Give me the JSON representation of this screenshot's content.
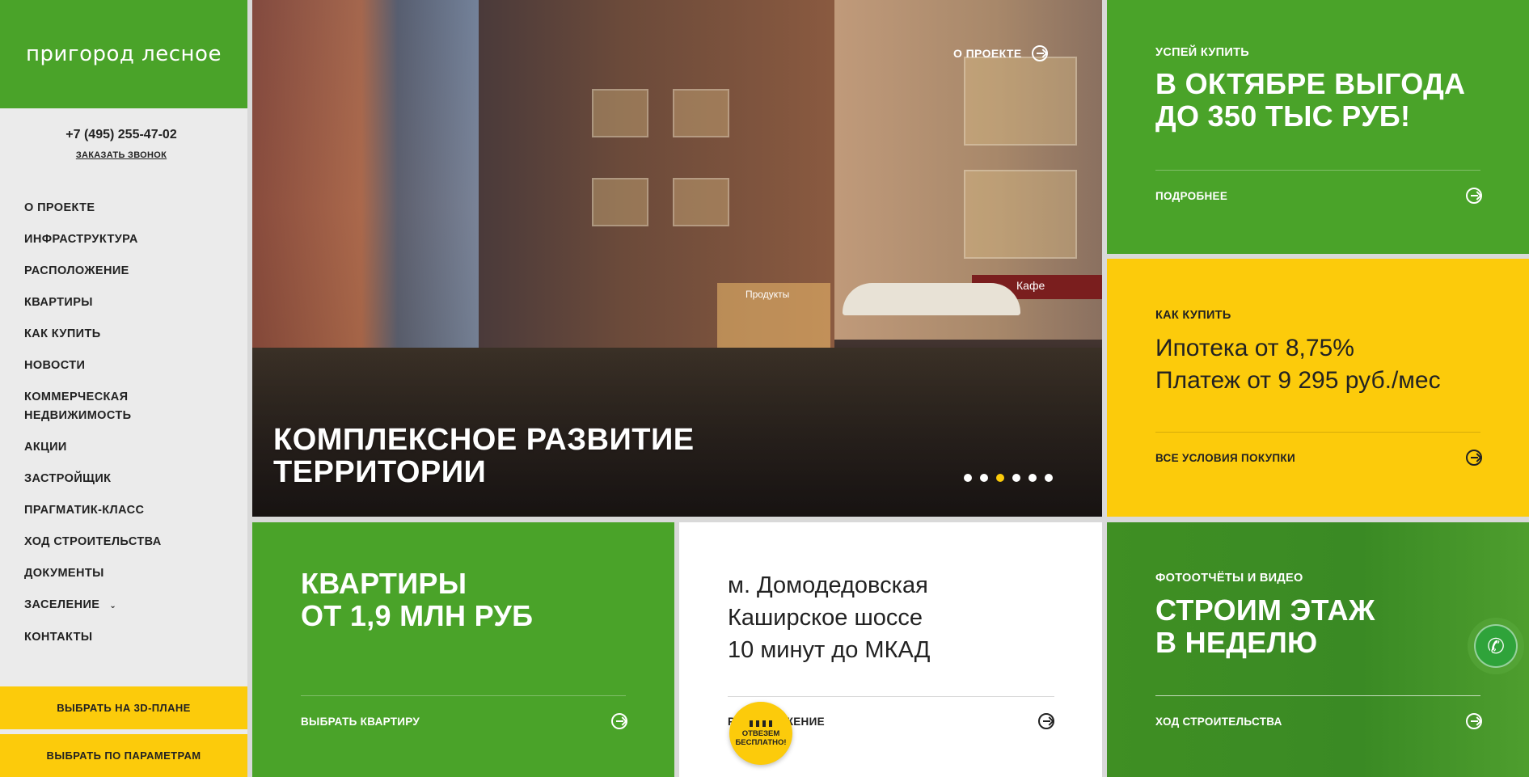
{
  "sidebar": {
    "logo": "пригород лесное",
    "phone": "+7 (495) 255-47-02",
    "callback": "ЗАКАЗАТЬ ЗВОНОК",
    "nav": [
      "О ПРОЕКТЕ",
      "ИНФРАСТРУКТУРА",
      "РАСПОЛОЖЕНИЕ",
      "КВАРТИРЫ",
      "КАК КУПИТЬ",
      "НОВОСТИ",
      "КОММЕРЧЕСКАЯ НЕДВИЖИМОСТЬ",
      "АКЦИИ",
      "ЗАСТРОЙЩИК",
      "ПРАГМАТИК-КЛАСС",
      "ХОД СТРОИТЕЛЬСТВА",
      "ДОКУМЕНТЫ",
      "ЗАСЕЛЕНИЕ",
      "КОНТАКТЫ"
    ],
    "btn_3d": "ВЫБРАТЬ НА 3D-ПЛАНЕ",
    "btn_params": "ВЫБРАТЬ ПО ПАРАМЕТРАМ"
  },
  "hero": {
    "about_link": "О ПРОЕКТЕ",
    "title_line1": "КОМПЛЕКСНОЕ РАЗВИТИЕ",
    "title_line2": "ТЕРРИТОРИИ",
    "shop_label": "Продукты",
    "cafe_label": "Кафе",
    "slides_total": 6,
    "active_slide": 3
  },
  "promo_october": {
    "eyebrow": "УСПЕЙ КУПИТЬ",
    "title_line1": "В ОКТЯБРЕ ВЫГОДА",
    "title_line2": "ДО 350 ТЫС РУБ!",
    "link": "ПОДРОБНЕЕ"
  },
  "promo_howtobuy": {
    "eyebrow": "КАК КУПИТЬ",
    "line1": "Ипотека от 8,75%",
    "line2": "Платеж от 9 295 руб./мес",
    "link": "ВСЕ УСЛОВИЯ ПОКУПКИ"
  },
  "promo_apartments": {
    "title_line1": "КВАРТИРЫ",
    "title_line2": "ОТ 1,9 МЛН РУБ",
    "link": "ВЫБРАТЬ КВАРТИРУ"
  },
  "promo_location": {
    "line1": "м. Домодедовская",
    "line2": "Каширское шоссе",
    "line3": "10 минут до МКАД",
    "link": "РАСПОЛОЖЕНИЕ",
    "taxi": "ОТВЕЗЕМ БЕСПЛАТНО!"
  },
  "promo_construction": {
    "eyebrow": "ФОТООТЧЁТЫ И ВИДЕО",
    "title_line1": "СТРОИМ ЭТАЖ",
    "title_line2": "В НЕДЕЛЮ",
    "link": "ХОД СТРОИТЕЛЬСТВА"
  },
  "colors": {
    "green": "#4aa329",
    "yellow": "#fccb0b",
    "sidebar_bg": "#ebebeb"
  }
}
